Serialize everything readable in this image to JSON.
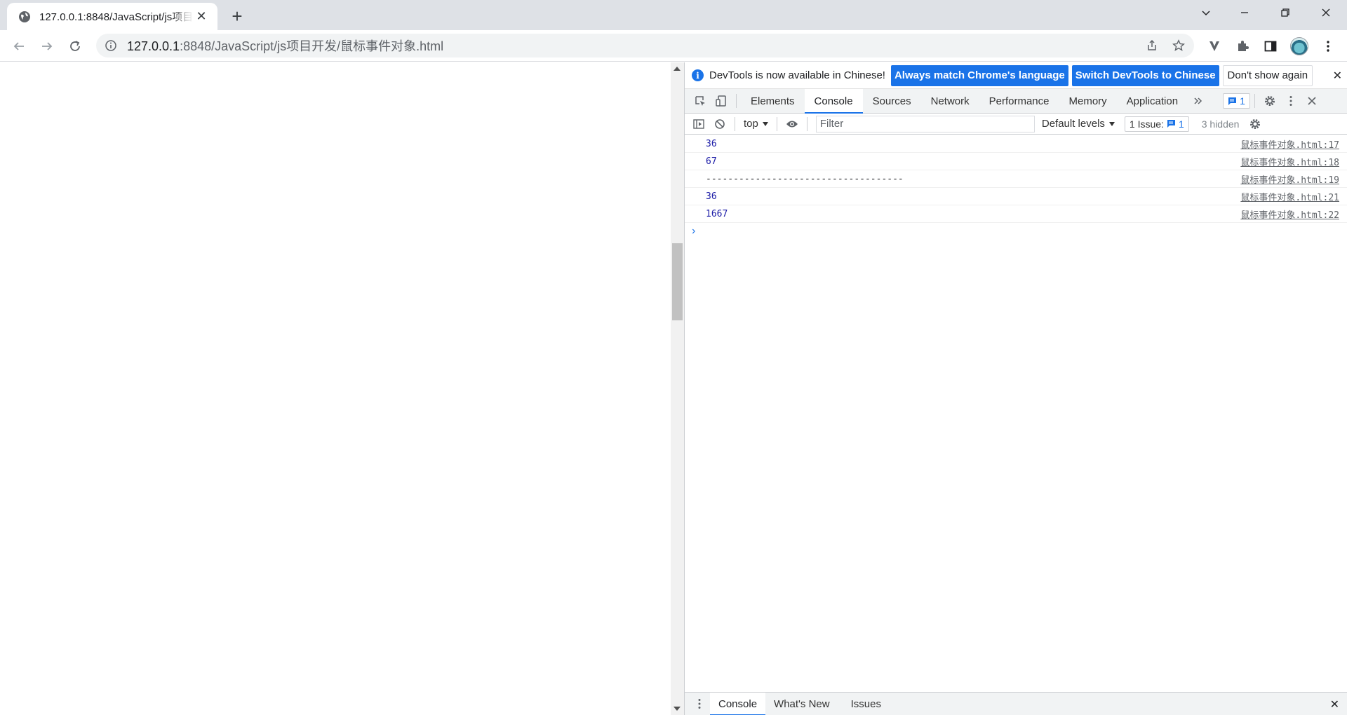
{
  "browser": {
    "tab_title": "127.0.0.1:8848/JavaScript/js项目开发/鼠标事件对象.html",
    "url_host": "127.0.0.1",
    "url_rest": ":8848/JavaScript/js项目开发/鼠标事件对象.html",
    "new_tab_label": "+"
  },
  "devtools": {
    "infobar": {
      "message": "DevTools is now available in Chinese!",
      "btn_match": "Always match Chrome's language",
      "btn_switch": "Switch DevTools to Chinese",
      "btn_dont_show": "Don't show again"
    },
    "tabs": [
      {
        "label": "Elements"
      },
      {
        "label": "Console"
      },
      {
        "label": "Sources"
      },
      {
        "label": "Network"
      },
      {
        "label": "Performance"
      },
      {
        "label": "Memory"
      },
      {
        "label": "Application"
      }
    ],
    "tab_issue_count": "1",
    "console_toolbar": {
      "context": "top",
      "filter_placeholder": "Filter",
      "levels": "Default levels",
      "issues_label": "1 Issue:",
      "issues_count": "1",
      "hidden": "3 hidden"
    },
    "logs": [
      {
        "value": "36",
        "source": "鼠标事件对象.html:17"
      },
      {
        "value": "67",
        "source": "鼠标事件对象.html:18"
      },
      {
        "value": "------------------------------------",
        "source": "鼠标事件对象.html:19"
      },
      {
        "value": "36",
        "source": "鼠标事件对象.html:21"
      },
      {
        "value": "1667",
        "source": "鼠标事件对象.html:22"
      }
    ],
    "prompt": "›",
    "drawer_tabs": [
      {
        "label": "Console"
      },
      {
        "label": "What's New"
      },
      {
        "label": "Issues"
      }
    ]
  },
  "colors": {
    "accent": "#1a73e8",
    "number_log": "#1a1aa6"
  }
}
